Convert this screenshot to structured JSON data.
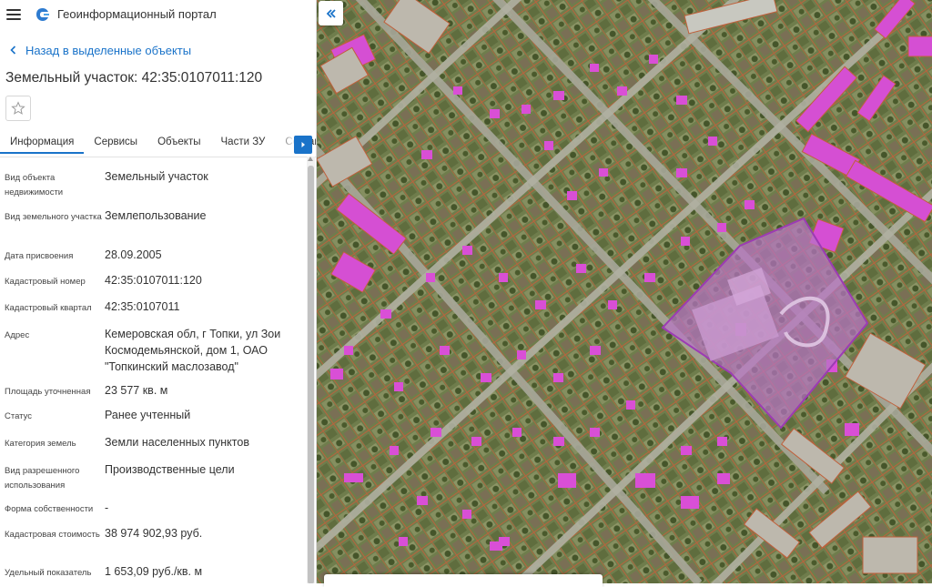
{
  "header": {
    "app_title": "Геоинформационный портал",
    "menu_icon": "menu-icon",
    "logo_icon": "portal-logo-icon"
  },
  "back_link": {
    "label": "Назад в выделенные объекты"
  },
  "object_title": "Земельный участок: 42:35:0107011:120",
  "tabs": [
    {
      "label": "Информация",
      "active": true
    },
    {
      "label": "Сервисы"
    },
    {
      "label": "Объекты"
    },
    {
      "label": "Части ЗУ"
    },
    {
      "label": "Состав"
    }
  ],
  "properties": [
    {
      "key": "Вид объекта недвижимости",
      "value": "Земельный участок"
    },
    {
      "key": "Вид земельного участка",
      "value": "Землепользование"
    },
    {
      "key": "Дата присвоения",
      "value": "28.09.2005"
    },
    {
      "key": "Кадастровый номер",
      "value": "42:35:0107011:120"
    },
    {
      "key": "Кадастровый квартал",
      "value": "42:35:0107011"
    },
    {
      "key": "Адрес",
      "value": "Кемеровская обл, г Топки, ул Зои Космодемьянской, дом 1, ОАО \"Топкинский маслозавод\""
    },
    {
      "key": "Площадь уточненная",
      "value": "23 577 кв. м"
    },
    {
      "key": "Статус",
      "value": "Ранее учтенный"
    },
    {
      "key": "Категория земель",
      "value": "Земли населенных пунктов"
    },
    {
      "key": "Вид разрешенного использования",
      "value": "Производственные цели"
    },
    {
      "key": "Форма собственности",
      "value": "-"
    },
    {
      "key": "Кадастровая стоимость",
      "value": "38 974 902,93 руб."
    },
    {
      "key": "Удельный показатель",
      "value": "1 653,09 руб./кв. м"
    }
  ],
  "colors": {
    "accent": "#1a73c9",
    "parcel_outline": "#c0603c",
    "building_fill": "#d94fd6",
    "selected_parcel": "#a85bb8"
  }
}
